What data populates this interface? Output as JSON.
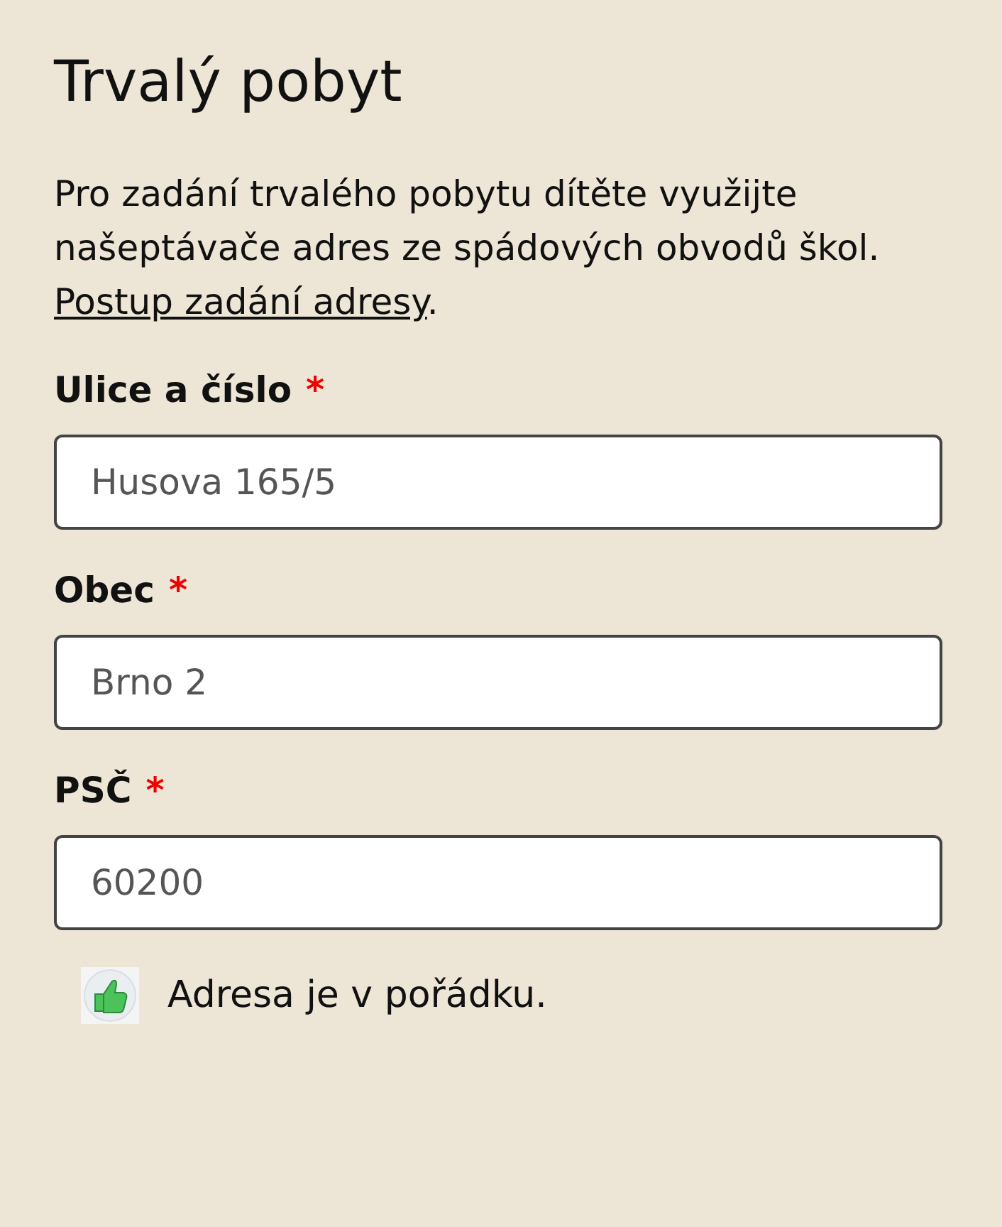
{
  "title": "Trvalý pobyt",
  "intro": {
    "text": "Pro zadání trvalého pobytu dítěte využijte našeptávače adres ze spádových obvodů škol. ",
    "link": "Postup zadání adresy",
    "after": "."
  },
  "fields": [
    {
      "label": "Ulice a číslo",
      "required": true,
      "value": "Husova 165/5"
    },
    {
      "label": "Obec",
      "required": true,
      "value": "Brno 2"
    },
    {
      "label": "PSČ",
      "required": true,
      "value": "60200"
    }
  ],
  "required_mark": "*",
  "status": {
    "ok": true,
    "text": "Adresa je v pořádku."
  }
}
